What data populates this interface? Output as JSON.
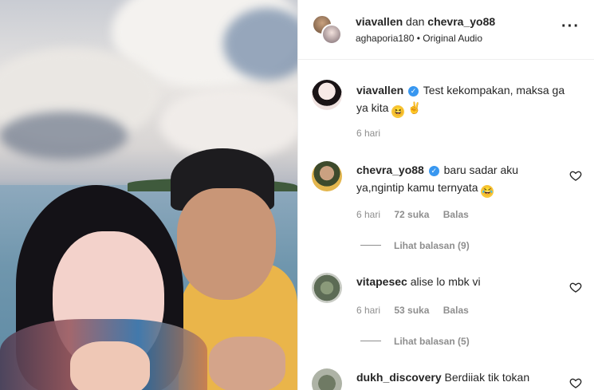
{
  "header": {
    "user1": "viavallen",
    "joiner": "dan",
    "user2": "chevra_yo88",
    "audio_owner": "aghaporia180",
    "audio_sep": "•",
    "audio_label": "Original Audio",
    "more_icon": "more-horizontal-icon"
  },
  "caption": {
    "username": "viavallen",
    "text": "Test kekompakan, maksa ga ya kita",
    "emoji_1": "😆",
    "emoji_2": "✌",
    "time": "6 hari"
  },
  "comments": [
    {
      "username": "chevra_yo88",
      "verified": true,
      "text": "baru sadar aku ya,ngintip kamu ternyata",
      "emoji": "😂",
      "time": "6 hari",
      "likes": "72 suka",
      "reply_label": "Balas",
      "view_replies": "Lihat balasan (9)"
    },
    {
      "username": "vitapesec",
      "verified": false,
      "text": "alise lo mbk vi",
      "time": "6 hari",
      "likes": "53 suka",
      "reply_label": "Balas",
      "view_replies": "Lihat balasan (5)"
    },
    {
      "username": "dukh_discovery",
      "verified": false,
      "text": "Berdiiak tik tokan"
    }
  ],
  "colors": {
    "verified": "#3897f0",
    "muted": "#8e8e8e",
    "text": "#262626"
  }
}
